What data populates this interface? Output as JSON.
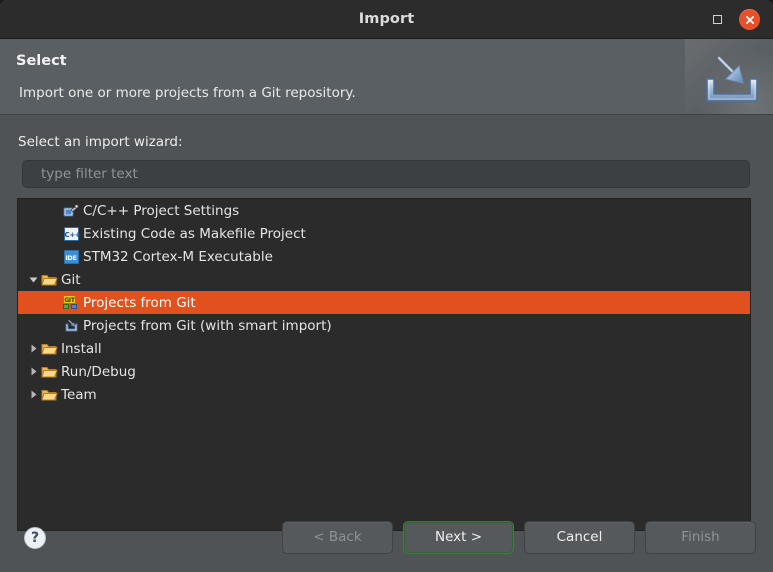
{
  "window": {
    "title": "Import",
    "controls": {
      "maximize": "maximize",
      "close": "close"
    }
  },
  "banner": {
    "title": "Select",
    "description": "Import one or more projects from a Git repository.",
    "icon": "import-wizard-icon"
  },
  "form": {
    "label": "Select an import wizard:",
    "filter": {
      "value": "",
      "placeholder": "type filter text"
    }
  },
  "tree": {
    "items": [
      {
        "label": "",
        "icon": "folder-icon",
        "indent": 0,
        "twisty": "none",
        "selected": false,
        "clipped": true
      },
      {
        "label": "C/C++ Project Settings",
        "icon": "cpp-settings-icon",
        "indent": 1,
        "twisty": "none",
        "selected": false
      },
      {
        "label": "Existing Code as Makefile Project",
        "icon": "cpp-badge-icon",
        "indent": 1,
        "twisty": "none",
        "selected": false
      },
      {
        "label": "STM32 Cortex-M Executable",
        "icon": "ide-badge-icon",
        "indent": 1,
        "twisty": "none",
        "selected": false
      },
      {
        "label": "Git",
        "icon": "folder-icon",
        "indent": 0,
        "twisty": "expanded",
        "selected": false
      },
      {
        "label": "Projects from Git",
        "icon": "git-badge-icon",
        "indent": 1,
        "twisty": "none",
        "selected": true
      },
      {
        "label": "Projects from Git (with smart import)",
        "icon": "smart-import-icon",
        "indent": 1,
        "twisty": "none",
        "selected": false
      },
      {
        "label": "Install",
        "icon": "folder-icon",
        "indent": 0,
        "twisty": "collapsed",
        "selected": false
      },
      {
        "label": "Run/Debug",
        "icon": "folder-icon",
        "indent": 0,
        "twisty": "collapsed",
        "selected": false
      },
      {
        "label": "Team",
        "icon": "folder-icon",
        "indent": 0,
        "twisty": "collapsed",
        "selected": false
      }
    ]
  },
  "footer": {
    "help": "?",
    "buttons": [
      {
        "label": "< Back",
        "state": "disabled"
      },
      {
        "label": "Next >",
        "state": "focused"
      },
      {
        "label": "Cancel",
        "state": "normal"
      },
      {
        "label": "Finish",
        "state": "disabled"
      }
    ]
  },
  "colors": {
    "selection": "#e0511d",
    "close_button": "#e7502a",
    "titlebar": "#2c2c2c",
    "banner": "#5a5f63",
    "body": "#4f5356",
    "tree_background": "#2b2b2b",
    "folder": "#e8a33d"
  }
}
